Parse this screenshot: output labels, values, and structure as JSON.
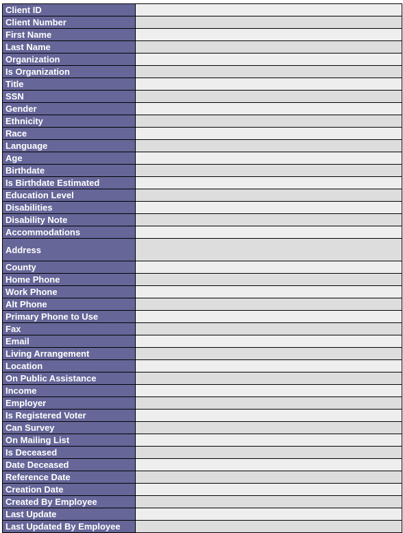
{
  "colors": {
    "label_bg": "#666699",
    "label_text": "#ffffff",
    "row_light": "#eeeeee",
    "row_dark": "#dddddd"
  },
  "fields": [
    {
      "label": "Client ID",
      "value": ""
    },
    {
      "label": "Client Number",
      "value": ""
    },
    {
      "label": "First Name",
      "value": ""
    },
    {
      "label": "Last Name",
      "value": ""
    },
    {
      "label": "Organization",
      "value": ""
    },
    {
      "label": "Is Organization",
      "value": ""
    },
    {
      "label": "Title",
      "value": ""
    },
    {
      "label": "SSN",
      "value": ""
    },
    {
      "label": "Gender",
      "value": ""
    },
    {
      "label": "Ethnicity",
      "value": ""
    },
    {
      "label": "Race",
      "value": ""
    },
    {
      "label": "Language",
      "value": ""
    },
    {
      "label": "Age",
      "value": ""
    },
    {
      "label": "Birthdate",
      "value": ""
    },
    {
      "label": "Is Birthdate Estimated",
      "value": ""
    },
    {
      "label": "Education Level",
      "value": ""
    },
    {
      "label": "Disabilities",
      "value": ""
    },
    {
      "label": "Disability Note",
      "value": ""
    },
    {
      "label": "Accommodations",
      "value": ""
    },
    {
      "label": "Address",
      "value": "",
      "tall": true
    },
    {
      "label": "County",
      "value": ""
    },
    {
      "label": "Home Phone",
      "value": ""
    },
    {
      "label": "Work Phone",
      "value": ""
    },
    {
      "label": "Alt Phone",
      "value": ""
    },
    {
      "label": "Primary Phone to Use",
      "value": ""
    },
    {
      "label": "Fax",
      "value": ""
    },
    {
      "label": "Email",
      "value": ""
    },
    {
      "label": "Living Arrangement",
      "value": ""
    },
    {
      "label": "Location",
      "value": ""
    },
    {
      "label": "On Public Assistance",
      "value": ""
    },
    {
      "label": "Income",
      "value": ""
    },
    {
      "label": "Employer",
      "value": ""
    },
    {
      "label": "Is Registered Voter",
      "value": ""
    },
    {
      "label": "Can Survey",
      "value": ""
    },
    {
      "label": "On Mailing List",
      "value": ""
    },
    {
      "label": "Is Deceased",
      "value": ""
    },
    {
      "label": "Date Deceased",
      "value": ""
    },
    {
      "label": "Reference Date",
      "value": ""
    },
    {
      "label": "Creation Date",
      "value": ""
    },
    {
      "label": "Created By Employee",
      "value": ""
    },
    {
      "label": "Last Update",
      "value": ""
    },
    {
      "label": "Last Updated By Employee",
      "value": ""
    }
  ]
}
